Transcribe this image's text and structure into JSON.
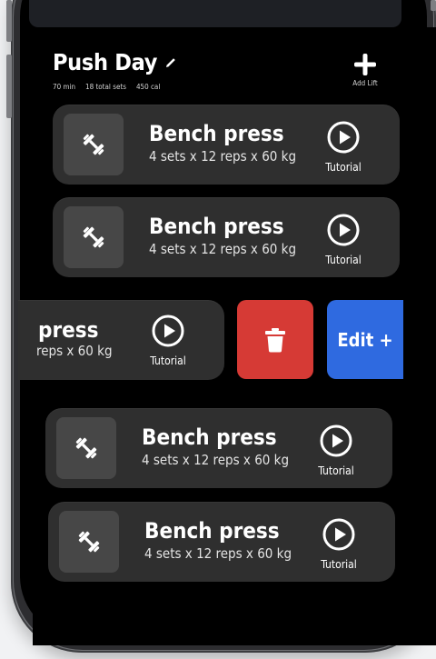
{
  "workout": {
    "title": "Push Day",
    "duration": "70 min",
    "total_sets": "18 total sets",
    "calories": "450 cal",
    "add_label": "Add Lift"
  },
  "lifts": [
    {
      "name": "Bench press",
      "detail": "4 sets x 12 reps x 60 kg",
      "tutorial": "Tutorial"
    },
    {
      "name": "Bench press",
      "detail": "4 sets x 12 reps x 60 kg",
      "tutorial": "Tutorial"
    },
    {
      "name": "press",
      "detail": "reps x 60 kg",
      "tutorial": "Tutorial"
    },
    {
      "name": "Bench press",
      "detail": "4 sets x 12 reps x 60 kg",
      "tutorial": "Tutorial"
    },
    {
      "name": "Bench press",
      "detail": "4 sets x 12 reps x 60 kg",
      "tutorial": "Tutorial"
    }
  ],
  "actions": {
    "edit_label": "Edit +"
  },
  "icons": {
    "edit": "pencil-icon",
    "add": "plus-icon",
    "lift": "dumbbell-icon",
    "tutorial": "play-circle-icon",
    "delete": "trash-icon"
  },
  "colors": {
    "background": "#000000",
    "card": "#2f2f2f",
    "thumb": "#474747",
    "delete": "#d63a35",
    "edit": "#2f6ae0"
  }
}
